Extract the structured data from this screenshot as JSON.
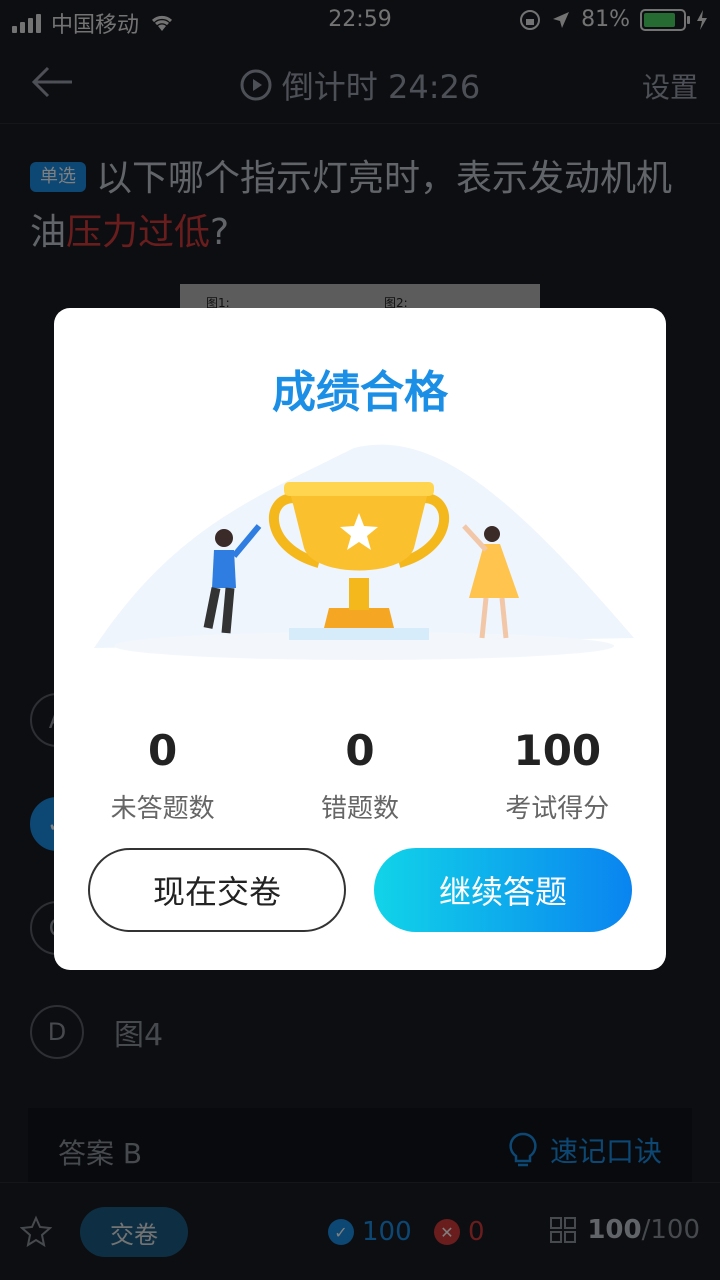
{
  "status_bar": {
    "carrier": "中国移动",
    "time": "22:59",
    "battery_text": "81%",
    "battery_level": 0.81
  },
  "nav": {
    "title": "倒计时 24:26",
    "settings_label": "设置"
  },
  "question": {
    "type_tag": "单选",
    "text_before": "以下哪个指示灯亮时，表示发动机机油",
    "text_highlight": "压力过低",
    "text_after": "?",
    "image_labels": [
      "图1:",
      "图2:"
    ]
  },
  "options": [
    {
      "letter": "A",
      "label": "",
      "state": "normal"
    },
    {
      "letter": "B",
      "label": "",
      "state": "correct"
    },
    {
      "letter": "C",
      "label": "",
      "state": "normal"
    },
    {
      "letter": "D",
      "label": "图4",
      "state": "normal"
    }
  ],
  "answer": {
    "text": "答案 B",
    "tip_label": "速记口诀"
  },
  "bottom_bar": {
    "submit_label": "交卷",
    "correct_count": "100",
    "wrong_count": "0",
    "progress_current": "100",
    "progress_total": "/100"
  },
  "modal": {
    "title": "成绩合格",
    "scores": [
      {
        "value": "0",
        "label": "未答题数"
      },
      {
        "value": "0",
        "label": "错题数"
      },
      {
        "value": "100",
        "label": "考试得分"
      }
    ],
    "submit_now_label": "现在交卷",
    "continue_label": "继续答题"
  },
  "colors": {
    "accent": "#1b8ee6",
    "danger": "#d23a3a",
    "gold": "#fbbf24"
  }
}
